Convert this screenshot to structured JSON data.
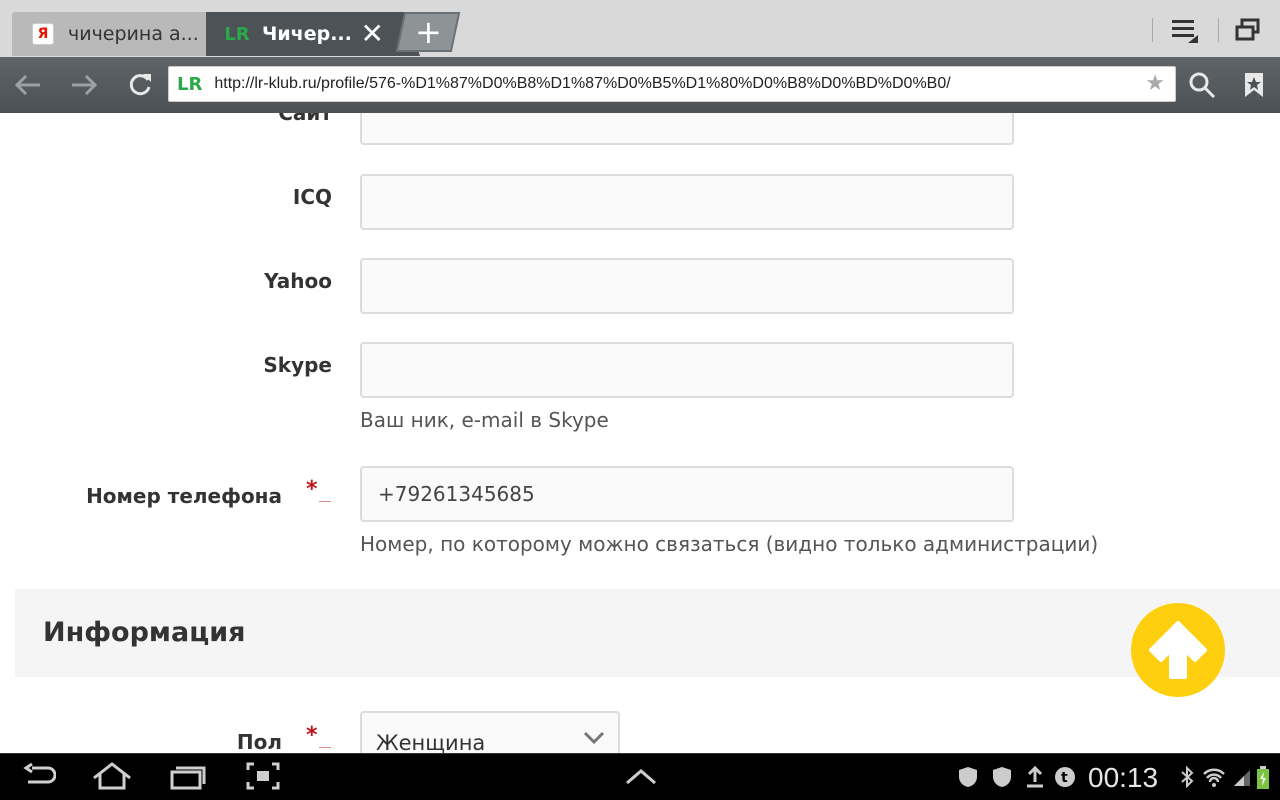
{
  "browser": {
    "tabs": [
      {
        "label": "чичерина а...",
        "favicon": "Я"
      },
      {
        "label": "Чичер...",
        "favicon": "LR"
      }
    ],
    "new_tab": "+",
    "url": "http://lr-klub.ru/profile/576-%D1%87%D0%B8%D1%87%D0%B5%D1%80%D0%B8%D0%BD%D0%B0/",
    "url_favicon": "LR"
  },
  "form": {
    "site_label": "Сайт",
    "icq_label": "ICQ",
    "yahoo_label": "Yahoo",
    "skype_label": "Skype",
    "skype_hint": "Ваш ник, e-mail в Skype",
    "phone_label": "Номер телефона",
    "phone_value": "+79261345685",
    "phone_hint": "Номер, по которому можно связаться (видно только администрации)",
    "required_mark": "*",
    "section_title": "Информация",
    "gender_label": "Пол",
    "gender_value": "Женщина"
  },
  "statusbar": {
    "time": "00:13"
  },
  "colors": {
    "accent_yellow": "#fecf0f",
    "required_red": "#c0141b",
    "brand_green": "#2aa84a"
  }
}
